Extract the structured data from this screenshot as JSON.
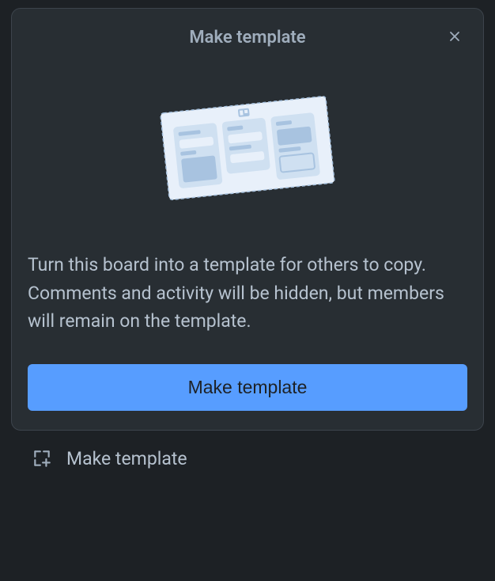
{
  "dialog": {
    "title": "Make template",
    "description": "Turn this board into a template for others to copy. Comments and activity will be hidden, but members will remain on the template.",
    "primary_button": "Make template"
  },
  "menu": {
    "make_template_label": "Make template"
  }
}
